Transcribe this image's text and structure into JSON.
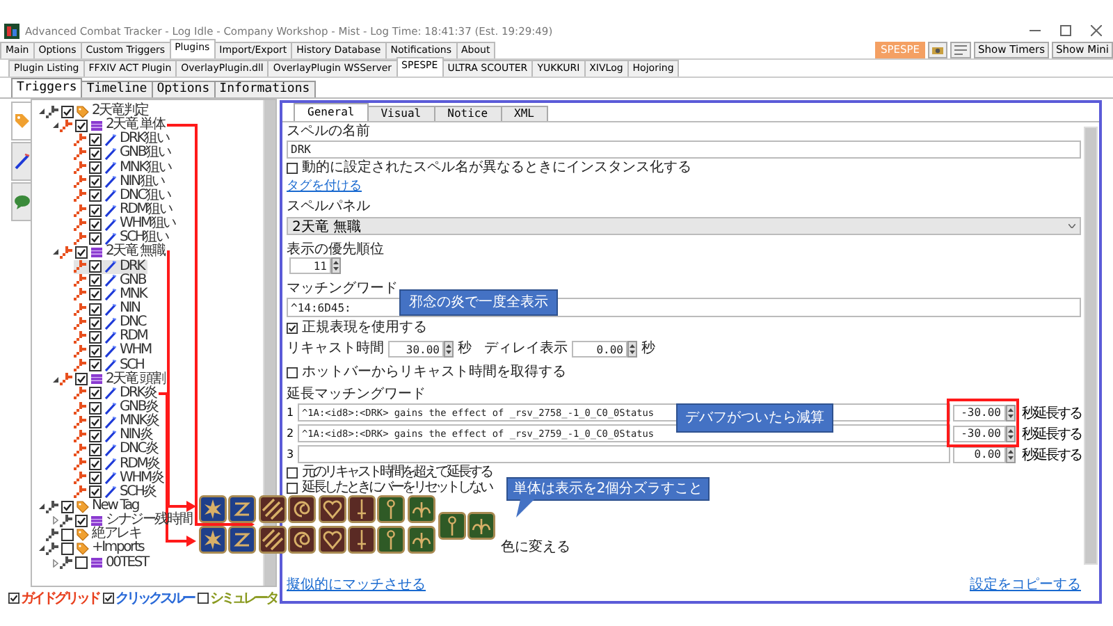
{
  "window": {
    "title": "Advanced Combat Tracker - Log Idle - Company Workshop - Mist - Log Time: 18:41:37 (Est. 19:29:49)"
  },
  "main_tabs": [
    {
      "label": "Main",
      "selected": false
    },
    {
      "label": "Options",
      "selected": false
    },
    {
      "label": "Custom Triggers",
      "selected": false
    },
    {
      "label": "Plugins",
      "selected": true
    },
    {
      "label": "Import/Export",
      "selected": false
    },
    {
      "label": "History Database",
      "selected": false
    },
    {
      "label": "Notifications",
      "selected": false
    },
    {
      "label": "About",
      "selected": false
    }
  ],
  "toolbar": {
    "spespe_button": "SPESPE",
    "buttons": [
      "Show Timers",
      "Show Mini"
    ]
  },
  "plugin_tabs": [
    {
      "label": "Plugin Listing",
      "selected": false
    },
    {
      "label": "FFXIV ACT Plugin",
      "selected": false
    },
    {
      "label": "OverlayPlugin.dll",
      "selected": false
    },
    {
      "label": "OverlayPlugin WSServer",
      "selected": false
    },
    {
      "label": "SPESPE",
      "selected": true
    },
    {
      "label": "ULTRA SCOUTER",
      "selected": false
    },
    {
      "label": "YUKKURI",
      "selected": false
    },
    {
      "label": "XIVLog",
      "selected": false
    },
    {
      "label": "Hojoring",
      "selected": false
    }
  ],
  "spespe_tabs": [
    {
      "label": "Triggers",
      "selected": true
    },
    {
      "label": "Timeline",
      "selected": false
    },
    {
      "label": "Options",
      "selected": false
    },
    {
      "label": "Informations",
      "selected": false
    }
  ],
  "side_tabs": [
    {
      "kind": "tag",
      "selected": true
    },
    {
      "kind": "wand",
      "selected": false
    },
    {
      "kind": "speech",
      "selected": false
    }
  ],
  "tree": [
    {
      "label": "2天竜判定",
      "kind": "tag",
      "checked": true,
      "expanded": true,
      "selected": false,
      "color": "#505050",
      "children": [
        {
          "label": "2天竜 単体",
          "kind": "panel",
          "checked": true,
          "expanded": true,
          "selected": false,
          "color": "#e8501e",
          "children": [
            {
              "label": "DRK狙い",
              "kind": "spell",
              "checked": true,
              "selected": false,
              "color": "#e8501e"
            },
            {
              "label": "GNB狙い",
              "kind": "spell",
              "checked": true,
              "selected": false,
              "color": "#e8501e"
            },
            {
              "label": "MNK狙い",
              "kind": "spell",
              "checked": true,
              "selected": false,
              "color": "#e8501e"
            },
            {
              "label": "NIN狙い",
              "kind": "spell",
              "checked": true,
              "selected": false,
              "color": "#e8501e"
            },
            {
              "label": "DNC狙い",
              "kind": "spell",
              "checked": true,
              "selected": false,
              "color": "#e8501e"
            },
            {
              "label": "RDM狙い",
              "kind": "spell",
              "checked": true,
              "selected": false,
              "color": "#e8501e"
            },
            {
              "label": "WHM狙い",
              "kind": "spell",
              "checked": true,
              "selected": false,
              "color": "#e8501e"
            },
            {
              "label": "SCH狙い",
              "kind": "spell",
              "checked": true,
              "selected": false,
              "color": "#e8501e"
            }
          ]
        },
        {
          "label": "2天竜 無職",
          "kind": "panel",
          "checked": true,
          "expanded": true,
          "selected": false,
          "color": "#e8501e",
          "children": [
            {
              "label": "DRK",
              "kind": "spell",
              "checked": true,
              "selected": true,
              "color": "#e8501e"
            },
            {
              "label": "GNB",
              "kind": "spell",
              "checked": true,
              "selected": false,
              "color": "#e8501e"
            },
            {
              "label": "MNK",
              "kind": "spell",
              "checked": true,
              "selected": false,
              "color": "#e8501e"
            },
            {
              "label": "NIN",
              "kind": "spell",
              "checked": true,
              "selected": false,
              "color": "#e8501e"
            },
            {
              "label": "DNC",
              "kind": "spell",
              "checked": true,
              "selected": false,
              "color": "#e8501e"
            },
            {
              "label": "RDM",
              "kind": "spell",
              "checked": true,
              "selected": false,
              "color": "#e8501e"
            },
            {
              "label": "WHM",
              "kind": "spell",
              "checked": true,
              "selected": false,
              "color": "#e8501e"
            },
            {
              "label": "SCH",
              "kind": "spell",
              "checked": true,
              "selected": false,
              "color": "#e8501e"
            }
          ]
        },
        {
          "label": "2天竜 頭割",
          "kind": "panel",
          "checked": true,
          "expanded": true,
          "selected": false,
          "color": "#e8501e",
          "children": [
            {
              "label": "DRK炎",
              "kind": "spell",
              "checked": true,
              "selected": false,
              "color": "#e8501e"
            },
            {
              "label": "GNB炎",
              "kind": "spell",
              "checked": true,
              "selected": false,
              "color": "#e8501e"
            },
            {
              "label": "MNK炎",
              "kind": "spell",
              "checked": true,
              "selected": false,
              "color": "#e8501e"
            },
            {
              "label": "NIN炎",
              "kind": "spell",
              "checked": true,
              "selected": false,
              "color": "#e8501e"
            },
            {
              "label": "DNC炎",
              "kind": "spell",
              "checked": true,
              "selected": false,
              "color": "#e8501e"
            },
            {
              "label": "RDM炎",
              "kind": "spell",
              "checked": true,
              "selected": false,
              "color": "#e8501e"
            },
            {
              "label": "WHM炎",
              "kind": "spell",
              "checked": true,
              "selected": false,
              "color": "#e8501e"
            },
            {
              "label": "SCH炎",
              "kind": "spell",
              "checked": true,
              "selected": false,
              "color": "#e8501e"
            }
          ]
        }
      ]
    },
    {
      "label": "New Tag",
      "kind": "tag",
      "checked": true,
      "expanded": true,
      "selected": false,
      "color": "#505050",
      "children": [
        {
          "label": "シナジー残時間",
          "kind": "panel",
          "checked": true,
          "expanded": false,
          "selected": false,
          "color": "#505050"
        }
      ]
    },
    {
      "label": "絶アレキ",
      "kind": "tag",
      "checked": false,
      "selected": false,
      "color": "#505050"
    },
    {
      "label": "+Imports",
      "kind": "tag",
      "checked": false,
      "expanded": true,
      "selected": false,
      "color": "#505050",
      "children": [
        {
          "label": "00TEST",
          "kind": "panel",
          "checked": false,
          "expanded": false,
          "selected": false,
          "color": "#505050"
        }
      ]
    }
  ],
  "tree_options": [
    {
      "label": "ガイドグリッド",
      "checked": true,
      "color": "#e8401e"
    },
    {
      "label": "クリックスルー",
      "checked": true,
      "color": "#2a6ad8"
    },
    {
      "label": "シミュレータ",
      "checked": false,
      "color": "#8a9a20"
    }
  ],
  "editor": {
    "tabs": [
      {
        "label": "General",
        "selected": true
      },
      {
        "label": "Visual",
        "selected": false
      },
      {
        "label": "Notice",
        "selected": false
      },
      {
        "label": "XML",
        "selected": false
      }
    ],
    "spell_name": {
      "label": "スペルの名前",
      "value": "DRK"
    },
    "instance_option": {
      "label": "動的に設定されたスペル名が異なるときにインスタンス化する",
      "checked": false
    },
    "tag_link": "タグを付ける",
    "spell_panel": {
      "label": "スペルパネル",
      "value": "2天竜 無職"
    },
    "priority": {
      "label": "表示の優先順位",
      "value": "11"
    },
    "matching_word": {
      "label": "マッチングワード",
      "value": "^14:6D45:"
    },
    "regex_option": {
      "label": "正規表現を使用する",
      "checked": true
    },
    "recast": {
      "label": "リキャスト時間",
      "value": "30.00",
      "unit": "秒"
    },
    "delay": {
      "label": "ディレイ表示",
      "value": "0.00",
      "unit": "秒"
    },
    "hotbar_option": {
      "label": "ホットバーからリキャスト時間を取得する",
      "checked": false
    },
    "extension": {
      "label": "延長マッチングワード",
      "rows": [
        {
          "number": "1",
          "pattern": "^1A:<id8>:<DRK> gains the effect of _rsv_2758_-1_0_C0_0Status",
          "seconds": "-30.00",
          "unit": "秒延長する"
        },
        {
          "number": "2",
          "pattern": "^1A:<id8>:<DRK> gains the effect of _rsv_2759_-1_0_C0_0Status",
          "seconds": "-30.00",
          "unit": "秒延長する"
        },
        {
          "number": "3",
          "pattern": "",
          "seconds": "0.00",
          "unit": "秒延長する"
        }
      ]
    },
    "exceed_option": {
      "label": "元のリキャスト時間を超えて延長する",
      "checked": false
    },
    "no_reset_option": {
      "label": "延長したときにバーをリセットしない",
      "checked": false
    },
    "color_change_text": "色に変える",
    "footer_links": [
      "擬似的にマッチさせる",
      "設定をコピーする"
    ]
  },
  "callouts": [
    {
      "text": "邪念の炎で一度全表示"
    },
    {
      "text": "デバフがついたら減算"
    },
    {
      "text": "単体は表示を2個分ズラすこと"
    }
  ],
  "job_icons": {
    "row_1": [
      {
        "kind": "burst",
        "color": "#1f3f8a"
      },
      {
        "kind": "zigzag",
        "color": "#1f3f8a"
      },
      {
        "kind": "stripes",
        "color": "#5a2a24"
      },
      {
        "kind": "spiral",
        "color": "#5a2a24"
      },
      {
        "kind": "heart",
        "color": "#5a2a24"
      },
      {
        "kind": "rapier",
        "color": "#5a2a24"
      },
      {
        "kind": "staff",
        "color": "#2f5a26"
      },
      {
        "kind": "scales",
        "color": "#2f5a26"
      }
    ],
    "row_2": [
      {
        "kind": "burst",
        "color": "#1f3f8a"
      },
      {
        "kind": "zigzag",
        "color": "#1f3f8a"
      },
      {
        "kind": "stripes",
        "color": "#5a2a24"
      },
      {
        "kind": "spiral",
        "color": "#5a2a24"
      },
      {
        "kind": "heart",
        "color": "#5a2a24"
      },
      {
        "kind": "rapier",
        "color": "#5a2a24"
      },
      {
        "kind": "staff",
        "color": "#2f5a26"
      },
      {
        "kind": "scales",
        "color": "#2f5a26"
      }
    ],
    "shifted": [
      {
        "kind": "staff",
        "color": "#2f5a26"
      },
      {
        "kind": "scales",
        "color": "#2f5a26"
      }
    ]
  }
}
